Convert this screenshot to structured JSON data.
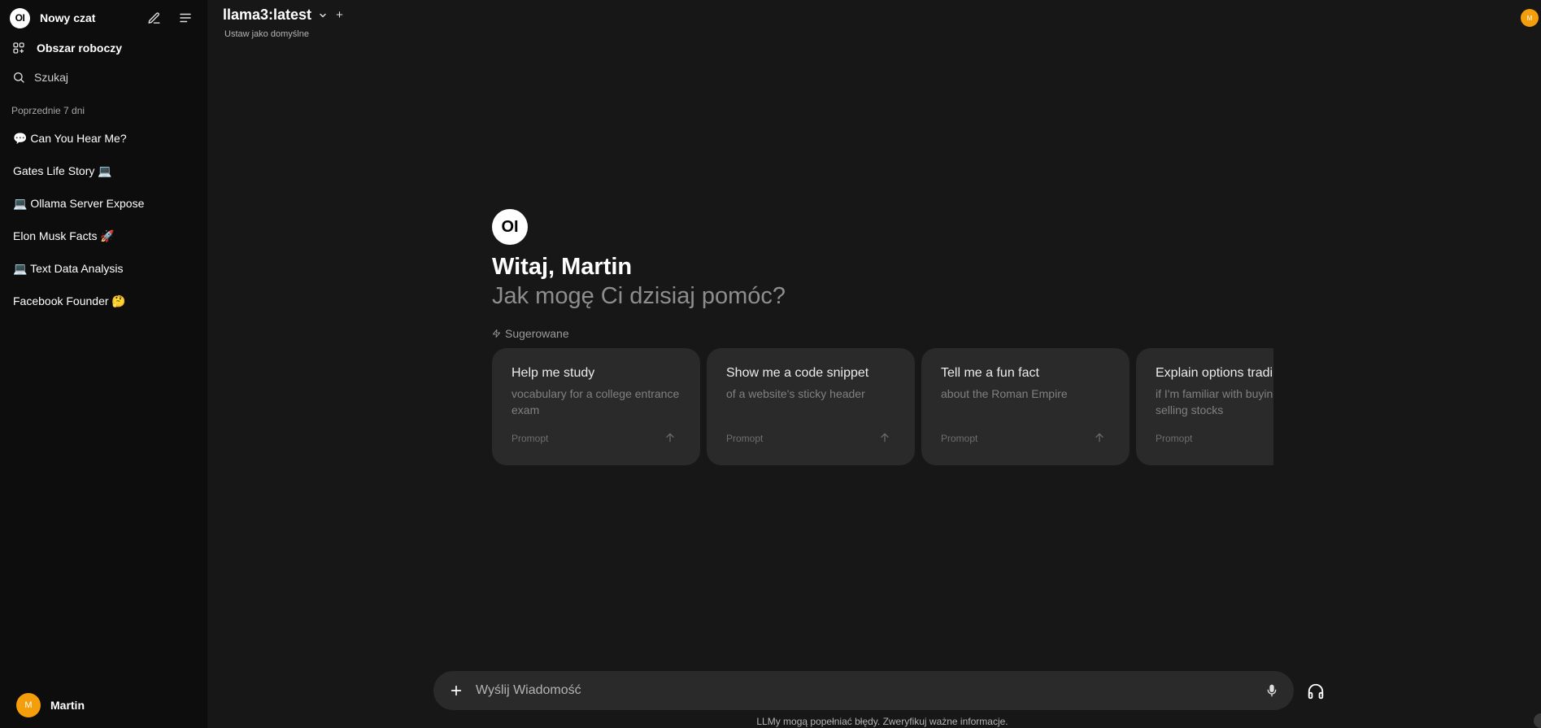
{
  "sidebar": {
    "logo_text": "OI",
    "new_chat_label": "Nowy czat",
    "workspace_label": "Obszar roboczy",
    "search_label": "Szukaj",
    "section_label": "Poprzednie 7 dni",
    "chats": [
      {
        "label": "💬 Can You Hear Me?"
      },
      {
        "label": "Gates Life Story 💻"
      },
      {
        "label": "💻 Ollama Server Expose"
      },
      {
        "label": "Elon Musk Facts 🚀"
      },
      {
        "label": "💻 Text Data Analysis"
      },
      {
        "label": "Facebook Founder 🤔"
      }
    ],
    "user": {
      "initial": "M",
      "name": "Martin"
    }
  },
  "header": {
    "model_name": "llama3:latest",
    "add_symbol": "+",
    "set_default_label": "Ustaw jako domyślne",
    "avatar_initial": "M"
  },
  "welcome": {
    "logo_text": "OI",
    "title": "Witaj, Martin",
    "subtitle": "Jak mogę Ci dzisiaj pomóc?",
    "suggested_label": "Sugerowane"
  },
  "suggestions": [
    {
      "title": "Help me study",
      "subtitle": "vocabulary for a college entrance exam",
      "tag": "Promopt"
    },
    {
      "title": "Show me a code snippet",
      "subtitle": "of a website's sticky header",
      "tag": "Promopt"
    },
    {
      "title": "Tell me a fun fact",
      "subtitle": "about the Roman Empire",
      "tag": "Promopt"
    },
    {
      "title": "Explain options trading",
      "subtitle": "if I'm familiar with buying and selling stocks",
      "tag": "Promopt"
    }
  ],
  "composer": {
    "placeholder": "Wyślij Wiadomość",
    "disclaimer": "LLMy mogą popełniać błędy. Zweryfikuj ważne informacje."
  },
  "colors": {
    "accent_avatar": "#f59e0b",
    "background": "#171717",
    "sidebar": "#0d0d0d",
    "card": "#2a2a2a"
  }
}
